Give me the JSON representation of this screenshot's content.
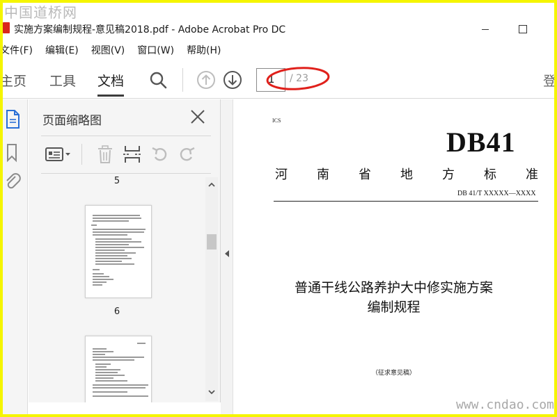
{
  "watermarks": {
    "top": "中国道桥网",
    "bottom": "www.cndao.com"
  },
  "window": {
    "title": "实施方案编制规程-意见稿2018.pdf - Adobe Acrobat Pro DC"
  },
  "menu": [
    "文件(F)",
    "编辑(E)",
    "视图(V)",
    "窗口(W)",
    "帮助(H)"
  ],
  "toolbar": {
    "tabs": [
      "主页",
      "工具",
      "文档"
    ],
    "active_tab": "文档",
    "current_page": "1",
    "total_pages": "/ 23",
    "right_cut_label": "登",
    "icons": [
      "search-icon",
      "page-up-icon",
      "page-down-icon"
    ]
  },
  "annotation": {
    "color": "#e0201b",
    "shape": "ellipse"
  },
  "thumbnails_panel": {
    "title": "页面缩略图",
    "tool_icons": [
      "page-options-icon",
      "delete-icon",
      "insert-page-icon",
      "rotate-ccw-icon",
      "rotate-cw-icon"
    ],
    "page_labels": [
      "5",
      "6"
    ]
  },
  "document": {
    "ics": "ICS",
    "code_big": "DB41",
    "province": [
      "河",
      "南",
      "省",
      "地",
      "方",
      "标",
      "准"
    ],
    "std_code": "DB 41/T  XXXXX—XXXX",
    "title_line1": "普通干线公路养护大中修实施方案",
    "title_line2": "编制规程",
    "draft_note": "（征求意见稿）"
  },
  "colors": {
    "yellow_frame": "#f5f500",
    "icon_gray": "#9a9a9a",
    "accent_blue": "#2a6fd6"
  }
}
